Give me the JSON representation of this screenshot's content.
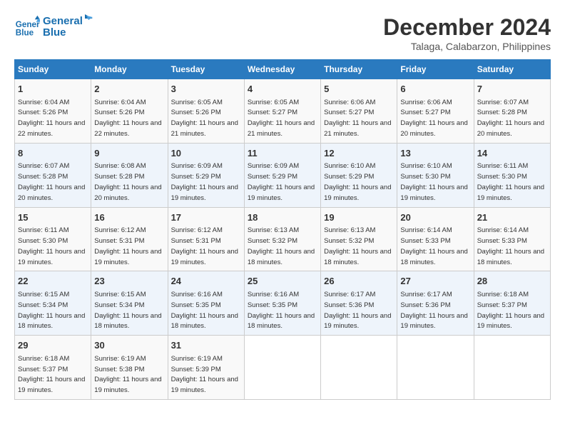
{
  "logo": {
    "line1": "General",
    "line2": "Blue"
  },
  "title": "December 2024",
  "location": "Talaga, Calabarzon, Philippines",
  "days_of_week": [
    "Sunday",
    "Monday",
    "Tuesday",
    "Wednesday",
    "Thursday",
    "Friday",
    "Saturday"
  ],
  "weeks": [
    [
      {
        "day": "1",
        "sunrise": "6:04 AM",
        "sunset": "5:26 PM",
        "daylight": "11 hours and 22 minutes."
      },
      {
        "day": "2",
        "sunrise": "6:04 AM",
        "sunset": "5:26 PM",
        "daylight": "11 hours and 22 minutes."
      },
      {
        "day": "3",
        "sunrise": "6:05 AM",
        "sunset": "5:26 PM",
        "daylight": "11 hours and 21 minutes."
      },
      {
        "day": "4",
        "sunrise": "6:05 AM",
        "sunset": "5:27 PM",
        "daylight": "11 hours and 21 minutes."
      },
      {
        "day": "5",
        "sunrise": "6:06 AM",
        "sunset": "5:27 PM",
        "daylight": "11 hours and 21 minutes."
      },
      {
        "day": "6",
        "sunrise": "6:06 AM",
        "sunset": "5:27 PM",
        "daylight": "11 hours and 20 minutes."
      },
      {
        "day": "7",
        "sunrise": "6:07 AM",
        "sunset": "5:28 PM",
        "daylight": "11 hours and 20 minutes."
      }
    ],
    [
      {
        "day": "8",
        "sunrise": "6:07 AM",
        "sunset": "5:28 PM",
        "daylight": "11 hours and 20 minutes."
      },
      {
        "day": "9",
        "sunrise": "6:08 AM",
        "sunset": "5:28 PM",
        "daylight": "11 hours and 20 minutes."
      },
      {
        "day": "10",
        "sunrise": "6:09 AM",
        "sunset": "5:29 PM",
        "daylight": "11 hours and 19 minutes."
      },
      {
        "day": "11",
        "sunrise": "6:09 AM",
        "sunset": "5:29 PM",
        "daylight": "11 hours and 19 minutes."
      },
      {
        "day": "12",
        "sunrise": "6:10 AM",
        "sunset": "5:29 PM",
        "daylight": "11 hours and 19 minutes."
      },
      {
        "day": "13",
        "sunrise": "6:10 AM",
        "sunset": "5:30 PM",
        "daylight": "11 hours and 19 minutes."
      },
      {
        "day": "14",
        "sunrise": "6:11 AM",
        "sunset": "5:30 PM",
        "daylight": "11 hours and 19 minutes."
      }
    ],
    [
      {
        "day": "15",
        "sunrise": "6:11 AM",
        "sunset": "5:30 PM",
        "daylight": "11 hours and 19 minutes."
      },
      {
        "day": "16",
        "sunrise": "6:12 AM",
        "sunset": "5:31 PM",
        "daylight": "11 hours and 19 minutes."
      },
      {
        "day": "17",
        "sunrise": "6:12 AM",
        "sunset": "5:31 PM",
        "daylight": "11 hours and 19 minutes."
      },
      {
        "day": "18",
        "sunrise": "6:13 AM",
        "sunset": "5:32 PM",
        "daylight": "11 hours and 18 minutes."
      },
      {
        "day": "19",
        "sunrise": "6:13 AM",
        "sunset": "5:32 PM",
        "daylight": "11 hours and 18 minutes."
      },
      {
        "day": "20",
        "sunrise": "6:14 AM",
        "sunset": "5:33 PM",
        "daylight": "11 hours and 18 minutes."
      },
      {
        "day": "21",
        "sunrise": "6:14 AM",
        "sunset": "5:33 PM",
        "daylight": "11 hours and 18 minutes."
      }
    ],
    [
      {
        "day": "22",
        "sunrise": "6:15 AM",
        "sunset": "5:34 PM",
        "daylight": "11 hours and 18 minutes."
      },
      {
        "day": "23",
        "sunrise": "6:15 AM",
        "sunset": "5:34 PM",
        "daylight": "11 hours and 18 minutes."
      },
      {
        "day": "24",
        "sunrise": "6:16 AM",
        "sunset": "5:35 PM",
        "daylight": "11 hours and 18 minutes."
      },
      {
        "day": "25",
        "sunrise": "6:16 AM",
        "sunset": "5:35 PM",
        "daylight": "11 hours and 18 minutes."
      },
      {
        "day": "26",
        "sunrise": "6:17 AM",
        "sunset": "5:36 PM",
        "daylight": "11 hours and 19 minutes."
      },
      {
        "day": "27",
        "sunrise": "6:17 AM",
        "sunset": "5:36 PM",
        "daylight": "11 hours and 19 minutes."
      },
      {
        "day": "28",
        "sunrise": "6:18 AM",
        "sunset": "5:37 PM",
        "daylight": "11 hours and 19 minutes."
      }
    ],
    [
      {
        "day": "29",
        "sunrise": "6:18 AM",
        "sunset": "5:37 PM",
        "daylight": "11 hours and 19 minutes."
      },
      {
        "day": "30",
        "sunrise": "6:19 AM",
        "sunset": "5:38 PM",
        "daylight": "11 hours and 19 minutes."
      },
      {
        "day": "31",
        "sunrise": "6:19 AM",
        "sunset": "5:39 PM",
        "daylight": "11 hours and 19 minutes."
      },
      null,
      null,
      null,
      null
    ]
  ],
  "labels": {
    "sunrise_prefix": "Sunrise: ",
    "sunset_prefix": "Sunset: ",
    "daylight_prefix": "Daylight: "
  }
}
